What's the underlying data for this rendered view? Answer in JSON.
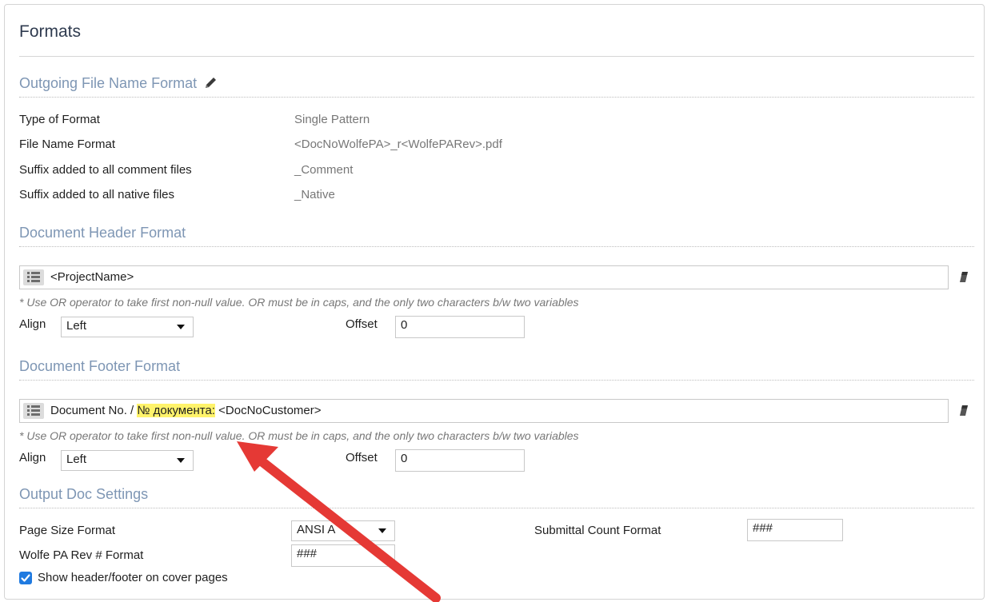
{
  "panel": {
    "title": "Formats"
  },
  "outgoing": {
    "title": "Outgoing File Name Format",
    "rows": [
      {
        "label": "Type of Format",
        "value": "Single Pattern"
      },
      {
        "label": "File Name Format",
        "value": "<DocNoWolfePA>_r<WolfePARev>.pdf"
      },
      {
        "label": "Suffix added to all comment files",
        "value": "_Comment"
      },
      {
        "label": "Suffix added to all native files",
        "value": "_Native"
      }
    ]
  },
  "header": {
    "title": "Document Header Format",
    "format_text": "<ProjectName>",
    "hint": "* Use OR operator to take first non-null value. OR must be in caps, and the only two characters b/w two variables",
    "align_label": "Align",
    "align_value": "Left",
    "offset_label": "Offset",
    "offset_value": "0"
  },
  "footer": {
    "title": "Document Footer Format",
    "format_prefix": "Document No. / ",
    "format_highlight": "№ документа:",
    "format_suffix": " <DocNoCustomer>",
    "hint": "* Use OR operator to take first non-null value. OR must be in caps, and the only two characters b/w two variables",
    "align_label": "Align",
    "align_value": "Left",
    "offset_label": "Offset",
    "offset_value": "0"
  },
  "output": {
    "title": "Output Doc Settings",
    "page_size_label": "Page Size Format",
    "page_size_value": "ANSI A",
    "submittal_label": "Submittal Count Format",
    "submittal_value": "###",
    "rev_label": "Wolfe PA Rev # Format",
    "rev_value": "###",
    "cover_label": "Show header/footer on cover pages",
    "cover_checked": true
  },
  "colors": {
    "section_title": "#7e96b4",
    "highlight": "#fff36b",
    "arrow": "#e53935",
    "checkbox": "#1f7ae0"
  },
  "icons": [
    "pencil-icon",
    "list-icon",
    "eraser-icon",
    "checkmark-icon",
    "red-arrow-annotation"
  ]
}
